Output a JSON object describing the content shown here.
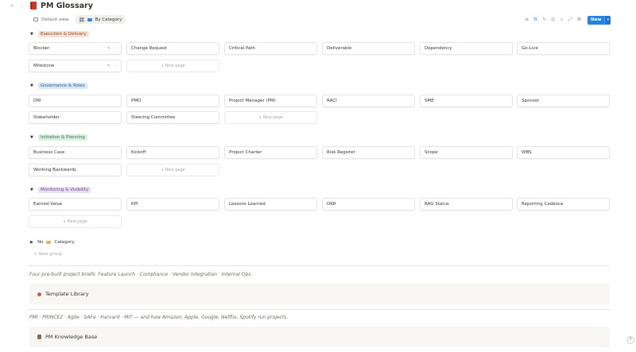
{
  "window_controls": "+ ⋮⋮",
  "page": {
    "title": "PM Glossary"
  },
  "views": [
    {
      "label": "Default view"
    },
    {
      "label": "By Category"
    }
  ],
  "toolbar": {
    "new_label": "New"
  },
  "new_page_label": "+ New page",
  "groups": [
    {
      "tag": "Execution & Delivery",
      "count": "",
      "cards": [
        "Blocker",
        "Change Request",
        "Critical Path",
        "Deliverable",
        "Dependency",
        "Go-Live",
        "Milestone"
      ]
    },
    {
      "tag": "Governance & Roles",
      "count": "",
      "cards": [
        "DRI",
        "PMO",
        "Project Manager (PM)",
        "RACI",
        "SME",
        "Sponsor",
        "Stakeholder",
        "Steering Committee"
      ]
    },
    {
      "tag": "Initiation & Planning",
      "count": "",
      "cards": [
        "Business Case",
        "Kickoff",
        "Project Charter",
        "Risk Register",
        "Scope",
        "WBS",
        "Working Backwards"
      ]
    },
    {
      "tag": "Monitoring & Visibility",
      "count": "",
      "cards": [
        "Earned Value",
        "KPI",
        "Lessons Learned",
        "OKR",
        "RAG Status",
        "Reporting Cadence"
      ]
    }
  ],
  "no_category": {
    "prefix": "No",
    "label": "Category"
  },
  "new_group_label": "+ New group",
  "note1": "Four pre-built project briefs: Feature Launch · Compliance · Vendor Integration · Internal Ops.",
  "callout1": "Template Library",
  "note2": "PMI · PRINCE2 · Agile · SAFe · Harvard · MIT — and how Amazon, Apple, Google, Netflix, Spotify run projects.",
  "callout2": "PM Knowledge Base",
  "help": "?"
}
